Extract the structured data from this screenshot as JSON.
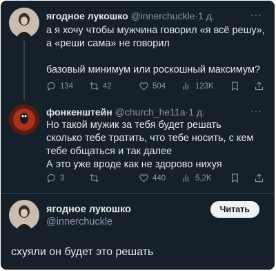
{
  "tweet1": {
    "name": "ягодное лукошко",
    "handle": "@innerchuckle",
    "separator": "·",
    "time": "1 д.",
    "more": "···",
    "lines": [
      "а я хочу чтобы мужчина говорил «я всё решу»,",
      "а «реши сама» не говорил",
      "",
      "базовый минимум или роскошный максимум?"
    ],
    "stats": {
      "replies": "134",
      "retweets": "42",
      "likes": "504",
      "views": "123K"
    }
  },
  "tweet2": {
    "name": "фонкенштейн",
    "handle": "@church_he11a",
    "separator": "·",
    "time": "1 д.",
    "more": "···",
    "lines": [
      "Но такой мужик за тебя будет решать",
      "сколько тебе тратить, что тебе носить, с кем",
      "тебе общаться и так далее",
      "А это уже вроде как не здорово нихуя"
    ],
    "stats": {
      "replies": "3",
      "retweets": "",
      "likes": "440",
      "views": "5,2K"
    }
  },
  "tweet3": {
    "name": "ягодное лукошко",
    "handle": "@innerchuckle",
    "follow_label": "Читать",
    "text": "схуяли он будет это решать"
  },
  "icons": [
    "reply-icon",
    "retweet-icon",
    "like-icon",
    "views-icon",
    "bookmark-icon",
    "share-icon"
  ],
  "colors": {
    "background": "#15202b",
    "text": "#e7e9ea",
    "secondary": "#8b98a5",
    "button": "#eff3f4"
  }
}
